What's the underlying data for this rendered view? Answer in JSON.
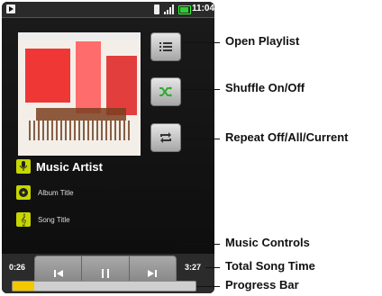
{
  "status_bar": {
    "time": "11:04",
    "icons": [
      "notification-icon",
      "bluetooth-icon",
      "signal-icon",
      "battery-icon"
    ]
  },
  "player": {
    "artist": "Music Artist",
    "album": "Album Title",
    "song": "Song Title",
    "elapsed": "0:26",
    "total": "3:27",
    "progress_fraction": 0.12,
    "accent_color": "#c6d600",
    "progress_color": "#f2c800",
    "controls": [
      "previous-icon",
      "pause-icon",
      "next-icon"
    ],
    "side_buttons": [
      "playlist-icon",
      "shuffle-icon",
      "repeat-icon"
    ]
  },
  "callouts": {
    "open_playlist": "Open Playlist",
    "shuffle": "Shuffle On/Off",
    "repeat": "Repeat Off/All/Current",
    "music_controls": "Music Controls",
    "total_time": "Total Song Time",
    "progress_bar": "Progress Bar"
  }
}
